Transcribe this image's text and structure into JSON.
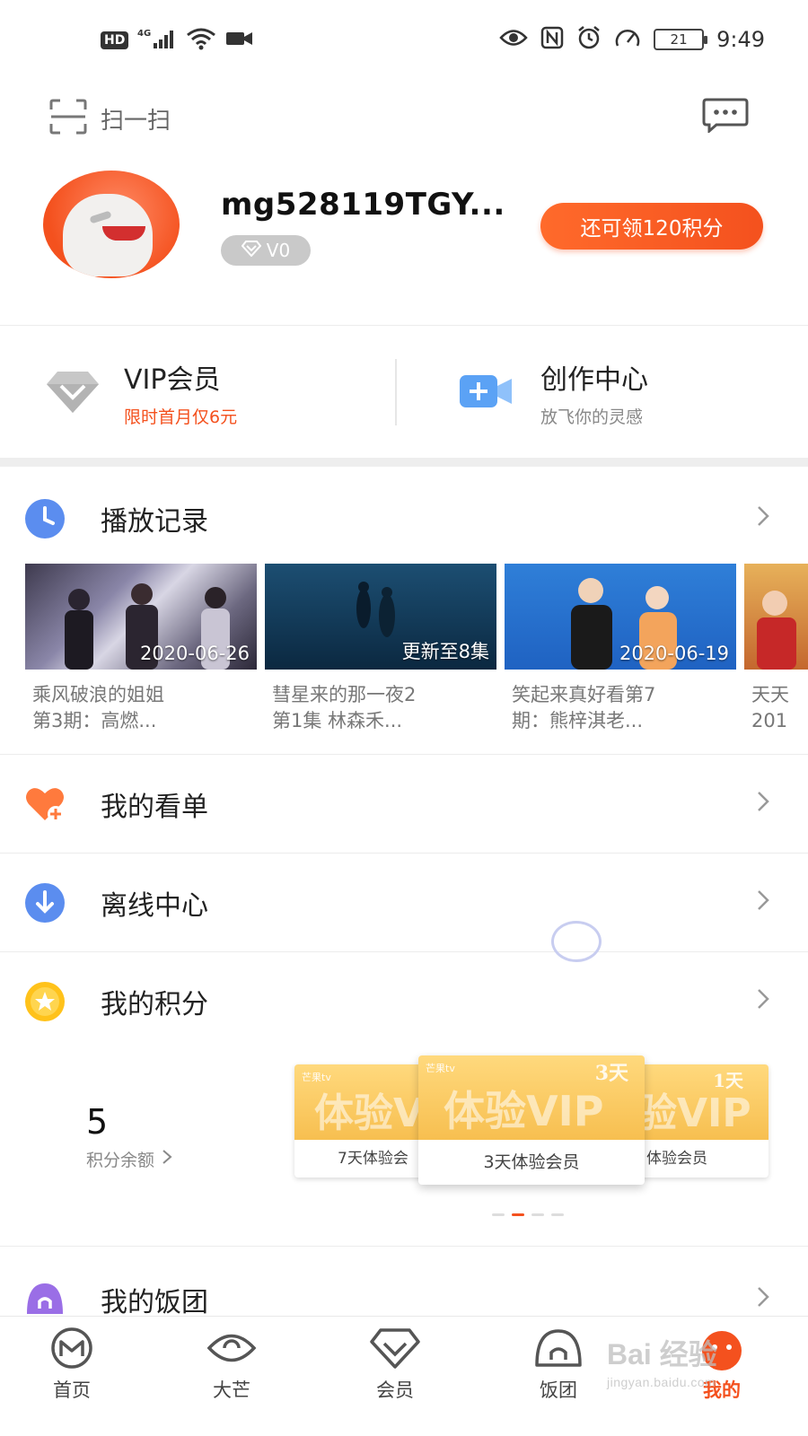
{
  "status_bar": {
    "hd": "HD",
    "network": "4G",
    "battery": "21",
    "time": "9:49"
  },
  "top_bar": {
    "scan_label": "扫一扫"
  },
  "profile": {
    "username": "mg528119TGY...",
    "vip_level": "V0",
    "points_button": "还可领120积分"
  },
  "features": {
    "vip": {
      "title": "VIP会员",
      "subtitle": "限时首月仅6元",
      "subtitle_color": "#f4511e"
    },
    "creator": {
      "title": "创作中心",
      "subtitle": "放飞你的灵感"
    }
  },
  "history": {
    "title": "播放记录",
    "items": [
      {
        "overlay": "2020-06-26",
        "caption_line1": "乘风破浪的姐姐",
        "caption_line2": "第3期：高燃..."
      },
      {
        "overlay": "更新至8集",
        "caption_line1": "彗星来的那一夜2",
        "caption_line2": "第1集 林森禾..."
      },
      {
        "overlay": "2020-06-19",
        "caption_line1": "笑起来真好看第7",
        "caption_line2": "期：熊梓淇老..."
      },
      {
        "overlay": "",
        "caption_line1": "天天",
        "caption_line2": "201"
      }
    ]
  },
  "menu": {
    "watchlist": "我的看单",
    "offline": "离线中心",
    "points": "我的积分",
    "fantuan": "我的饭团"
  },
  "points": {
    "balance": "5",
    "balance_label": "积分余额",
    "coupons": [
      {
        "big": "体验V",
        "name": "7天体验会",
        "brand": "芒果tv"
      },
      {
        "big": "体验VIP",
        "days": "3天",
        "name": "3天体验会员",
        "brand": "芒果tv"
      },
      {
        "big": "验VIP",
        "days": "1天",
        "name": "体验会员"
      }
    ],
    "carousel_active_index": 1,
    "carousel_count": 4
  },
  "bottom_nav": [
    {
      "label": "首页",
      "icon": "home-m-icon"
    },
    {
      "label": "大芒",
      "icon": "eye-icon"
    },
    {
      "label": "会员",
      "icon": "vip-diamond-icon"
    },
    {
      "label": "饭团",
      "icon": "fantuan-icon"
    },
    {
      "label": "我的",
      "icon": "me-icon",
      "active": true
    }
  ],
  "watermark": {
    "text": "Bai 经验",
    "sub": "jingyan.baidu.com"
  },
  "colors": {
    "accent": "#f4511e",
    "gold": "#f7bf50",
    "blue": "#5b8def"
  }
}
